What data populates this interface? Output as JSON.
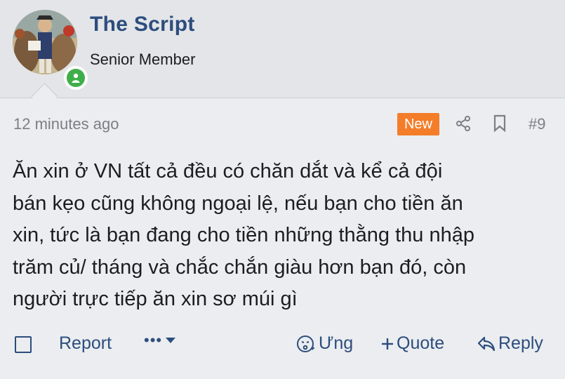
{
  "author": {
    "name": "The Script",
    "title": "Senior Member",
    "status_color": "#3fae49"
  },
  "post": {
    "time": "12 minutes ago",
    "badge": "New",
    "badge_color": "#f47d2a",
    "number": "#9",
    "body": "Ăn xin ở VN tất cả đều có chăn dắt và kể cả đội\nbán kẹo cũng không ngoại lệ, nếu bạn cho tiền ăn\nxin, tức là bạn đang cho tiền những thằng thu nhập\ntrăm củ/ tháng và chắc chắn giàu hơn bạn đó, còn\nngười trực tiếp ăn xin sơ múi gì"
  },
  "actions": {
    "report": "Report",
    "more": "•••",
    "react": "Ưng",
    "quote": "Quote",
    "reply": "Reply"
  },
  "icons": [
    "user-icon",
    "share-icon",
    "bookmark-icon",
    "chevron-down-icon",
    "react-icon",
    "plus-icon",
    "reply-arrow-icon"
  ],
  "accent_color": "#2c4d7d"
}
